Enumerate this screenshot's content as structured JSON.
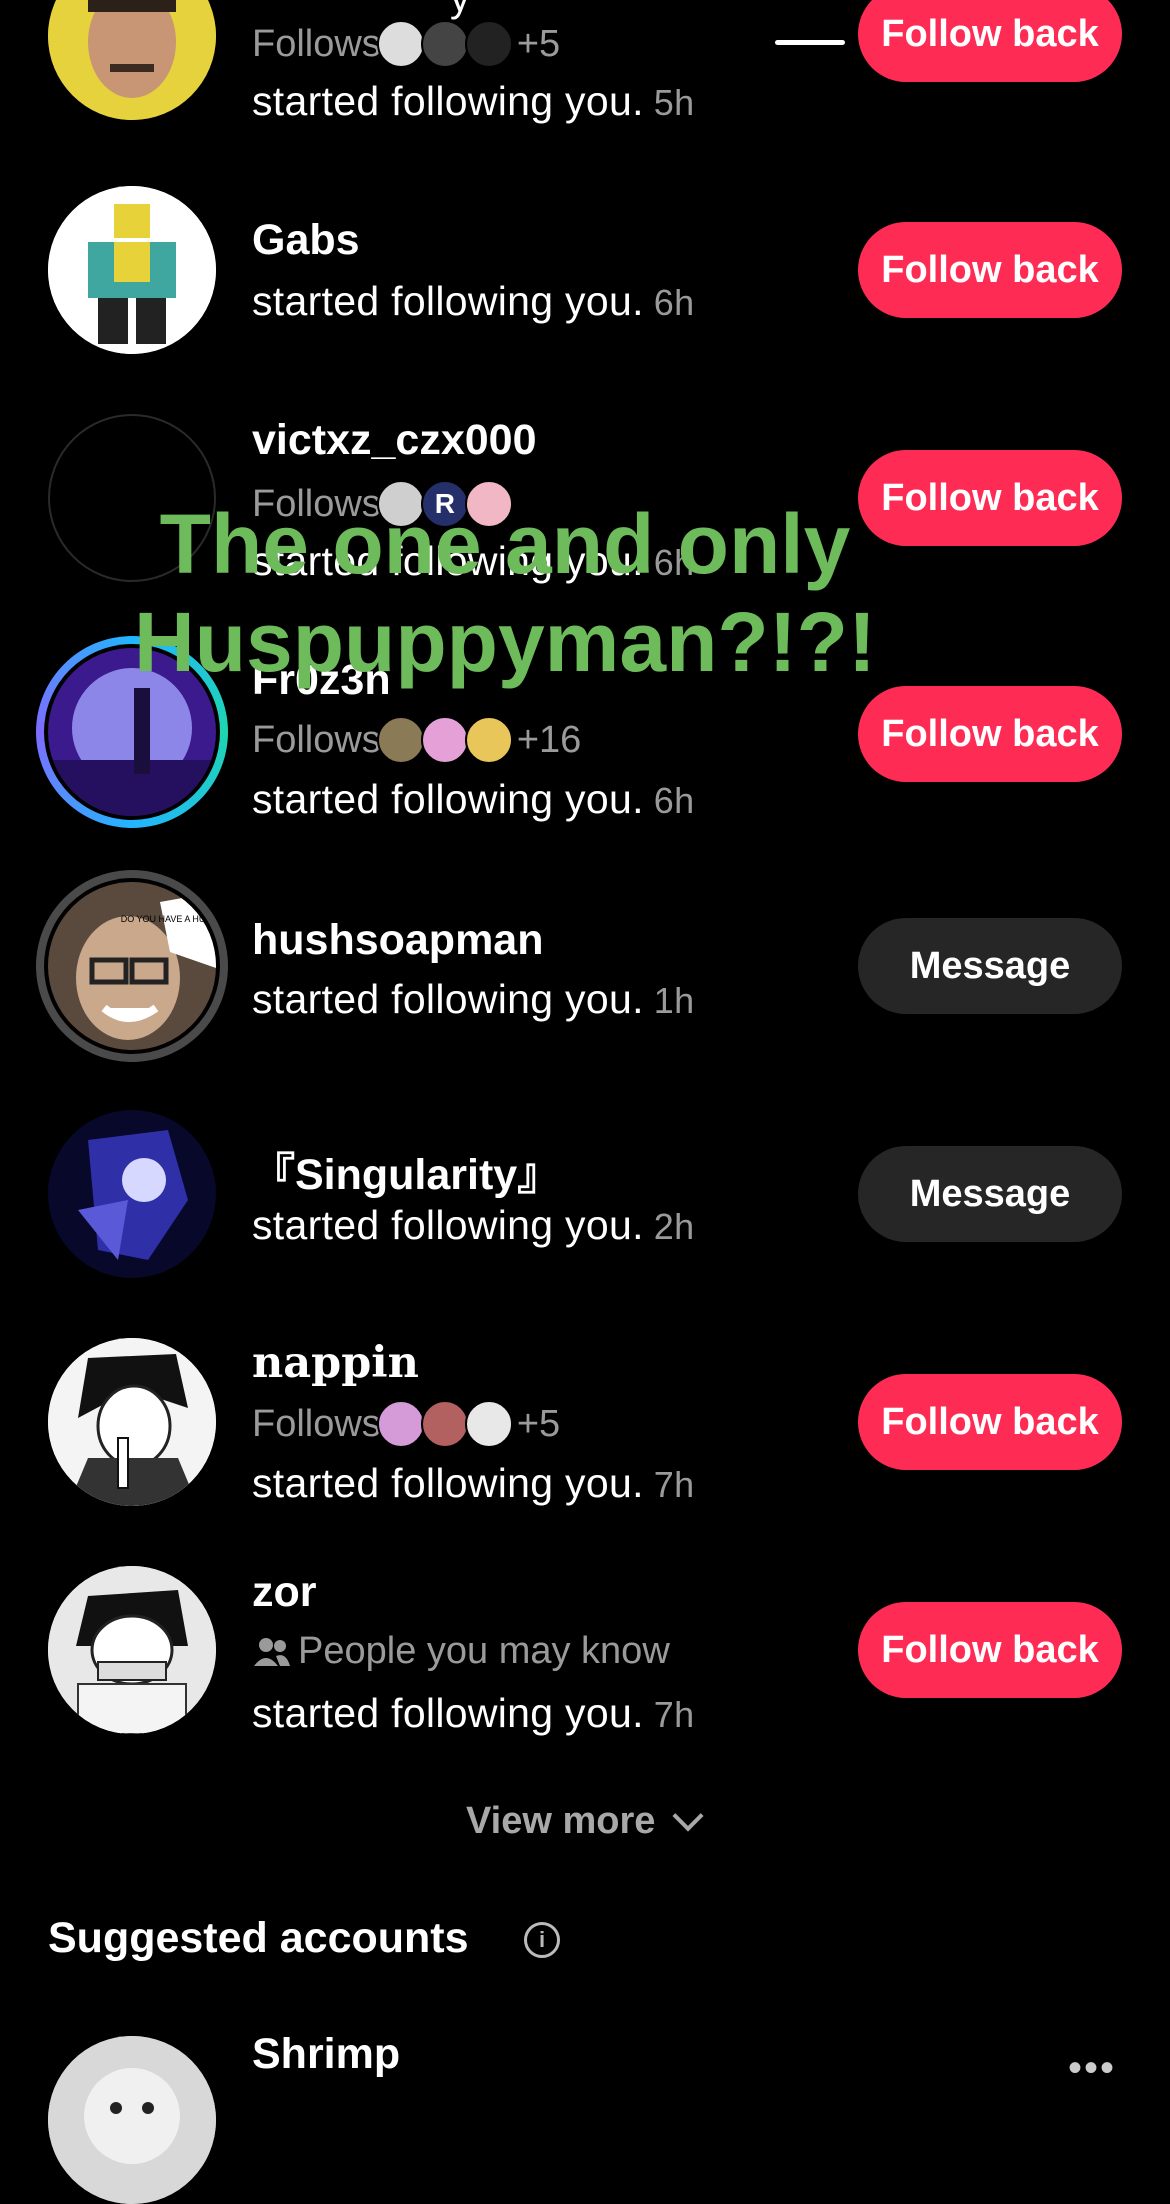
{
  "header": {
    "title_fragment": "y"
  },
  "overlay": {
    "line1": "The one and only",
    "line2": "Huspuppyman?!?!"
  },
  "notifications": [
    {
      "username": "",
      "follows_label": "Follows",
      "follows_more": "+5",
      "activity": "started following you.",
      "time": "5h",
      "button": "Follow back"
    },
    {
      "username": "Gabs",
      "activity": "started following you.",
      "time": "6h",
      "button": "Follow back"
    },
    {
      "username": "victxz_czx000",
      "follows_label": "Follows",
      "activity": "started following you.",
      "time": "6h",
      "button": "Follow back"
    },
    {
      "username": "Fr0z3n",
      "follows_label": "Follows",
      "follows_more": "+16",
      "activity": "started following you.",
      "time": "6h",
      "button": "Follow back"
    },
    {
      "username": "hushsoapman",
      "activity": "started following you.",
      "time": "1h",
      "button": "Message",
      "avatar_text": "DO YOU HAVE A HUMAN HEART?"
    },
    {
      "username": "『Singularity』",
      "activity": "started following you.",
      "time": "2h",
      "button": "Message"
    },
    {
      "username": "nappin",
      "follows_label": "Follows",
      "follows_more": "+5",
      "activity": "started following you.",
      "time": "7h",
      "button": "Follow back"
    },
    {
      "username": "zor",
      "suggestion": "People you may know",
      "activity": "started following you.",
      "time": "7h",
      "button": "Follow back"
    }
  ],
  "view_more": "View more",
  "suggested": {
    "title": "Suggested accounts",
    "accounts": [
      {
        "username": "Shrimp"
      }
    ]
  },
  "colors": {
    "follow_button": "#fe2c55",
    "message_button": "#262626",
    "overlay_text": "#6dbb5a"
  },
  "icons": [
    "back-chevron-icon",
    "people-icon",
    "info-icon",
    "chevron-down-icon",
    "more-dots-icon"
  ]
}
